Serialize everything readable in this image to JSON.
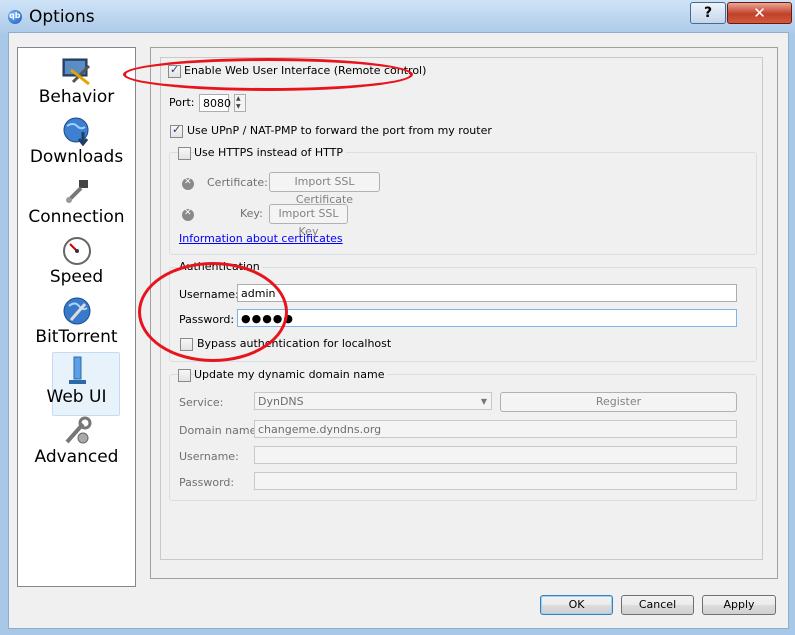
{
  "window": {
    "title": "Options",
    "help": "?",
    "close": "✕"
  },
  "sidebar": {
    "items": [
      {
        "label": "Behavior",
        "icon": "behavior-icon"
      },
      {
        "label": "Downloads",
        "icon": "downloads-globe-icon"
      },
      {
        "label": "Connection",
        "icon": "connection-plug-icon"
      },
      {
        "label": "Speed",
        "icon": "speedometer-icon"
      },
      {
        "label": "BitTorrent",
        "icon": "bittorrent-globe-icon"
      },
      {
        "label": "Web UI",
        "icon": "web-ui-tower-icon"
      },
      {
        "label": "Advanced",
        "icon": "advanced-tools-icon"
      }
    ],
    "selected": "Web UI"
  },
  "webui": {
    "enable_label": "Enable Web User Interface (Remote control)",
    "enable_checked": true,
    "port_label": "Port:",
    "port_value": "8080",
    "upnp_label": "Use UPnP / NAT-PMP to forward the port from my router",
    "upnp_checked": true,
    "https_label": "Use HTTPS instead of HTTP",
    "https_checked": false,
    "certificate_label": "Certificate:",
    "certificate_button": "Import SSL Certificate",
    "key_label": "Key:",
    "key_button": "Import SSL Key",
    "info_link": "Information about certificates",
    "auth_title": "Authentication",
    "username_label": "Username:",
    "username_value": "admin",
    "password_label": "Password:",
    "password_value": "●●●●●",
    "bypass_label": "Bypass authentication for localhost",
    "bypass_checked": false
  },
  "dyndns": {
    "group_label": "Update my dynamic domain name",
    "checked": false,
    "service_label": "Service:",
    "service_value": "DynDNS",
    "register_button": "Register",
    "domain_label": "Domain name:",
    "domain_value": "changeme.dyndns.org",
    "username_label": "Username:",
    "password_label": "Password:"
  },
  "footer": {
    "ok": "OK",
    "cancel": "Cancel",
    "apply": "Apply"
  },
  "colors": {
    "annotation": "#e8141d",
    "titlebar": "#a9c8e8"
  }
}
